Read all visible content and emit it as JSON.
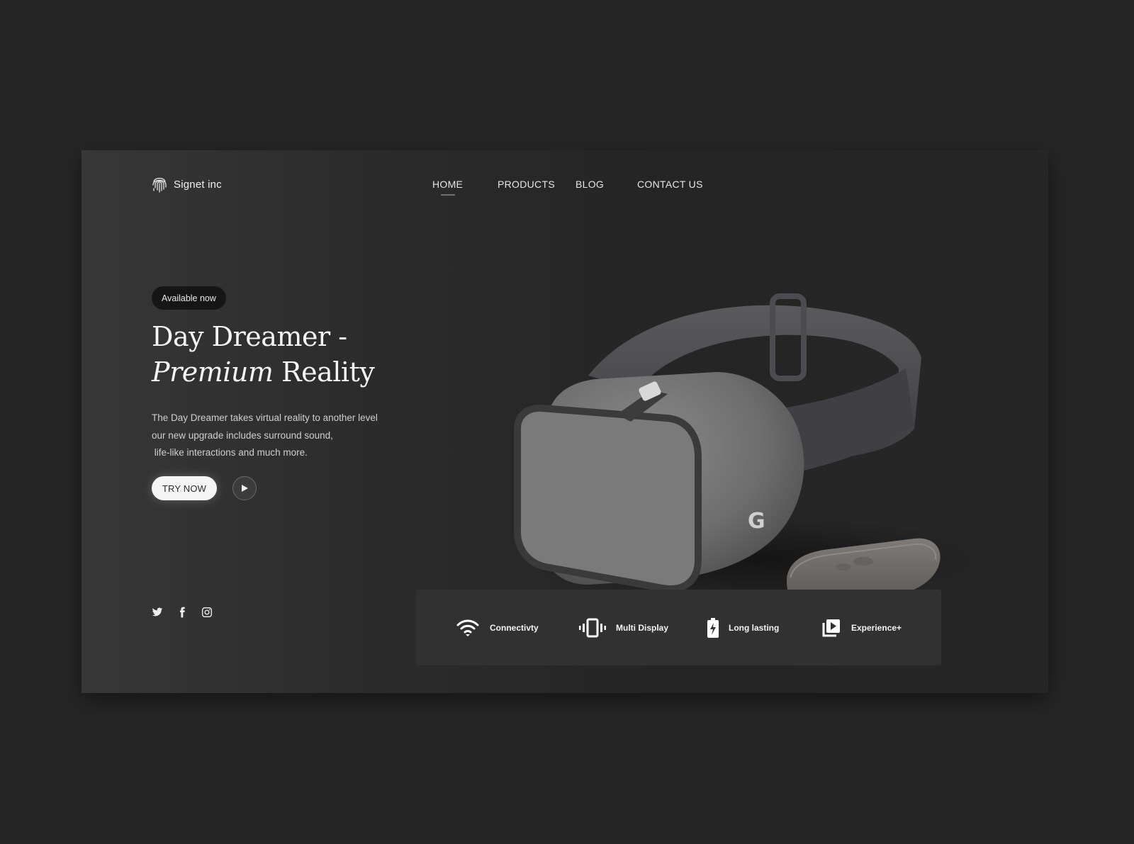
{
  "brand": {
    "name": "Signet inc",
    "logo_icon": "fingerprint-icon"
  },
  "nav": {
    "items": [
      {
        "label": "HOME",
        "active": true
      },
      {
        "label": "PRODUCTS"
      },
      {
        "label": "BLOG"
      },
      {
        "label": "CONTACT US"
      }
    ]
  },
  "hero": {
    "badge": "Available now",
    "title_line1": "Day Dreamer -",
    "title_line2_italic": "Premium",
    "title_line2_rest": " Reality",
    "description": [
      "The Day Dreamer takes virtual reality to another level",
      "our new upgrade includes surround sound,",
      " life-like interactions and much more."
    ],
    "cta_label": "TRY NOW",
    "play_icon": "play-icon"
  },
  "social": {
    "icons": [
      "twitter-icon",
      "facebook-icon",
      "instagram-icon"
    ]
  },
  "features": [
    {
      "icon": "wifi-icon",
      "label": "Connectivty"
    },
    {
      "icon": "vibrate-phone-icon",
      "label": "Multi Display"
    },
    {
      "icon": "battery-charging-icon",
      "label": "Long lasting"
    },
    {
      "icon": "video-library-icon",
      "label": "Experience+"
    }
  ],
  "product": {
    "image": "vr-headset-with-controller",
    "headset_logo": "G"
  },
  "colors": {
    "background": "#262626",
    "card": "#2b2b2b",
    "features_bar": "#313131",
    "text": "#f4f4f4"
  }
}
